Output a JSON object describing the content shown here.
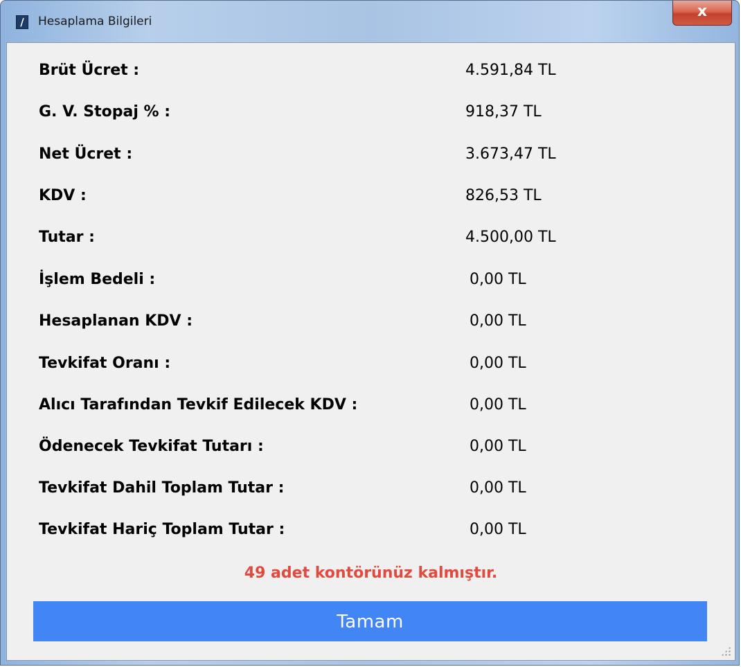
{
  "window": {
    "title": "Hesaplama Bilgileri",
    "app_icon": "app-logo-icon",
    "close_icon": "close-icon",
    "close_glyph": "x"
  },
  "rows": [
    {
      "label": "Brüt Ücret :",
      "value": "4.591,84 TL"
    },
    {
      "label": "G. V.  Stopaj % :",
      "value": "918,37 TL"
    },
    {
      "label": "Net Ücret :",
      "value": "3.673,47 TL"
    },
    {
      "label": "KDV :",
      "value": "826,53 TL"
    },
    {
      "label": "Tutar :",
      "value": "4.500,00 TL"
    },
    {
      "label": "İşlem Bedeli :",
      "value": "0,00 TL"
    },
    {
      "label": "Hesaplanan KDV :",
      "value": "0,00 TL"
    },
    {
      "label": "Tevkifat Oranı :",
      "value": "0,00 TL"
    },
    {
      "label": "Alıcı Tarafından Tevkif Edilecek KDV :",
      "value": "0,00 TL"
    },
    {
      "label": "Ödenecek Tevkifat Tutarı :",
      "value": "0,00 TL"
    },
    {
      "label": "Tevkifat Dahil Toplam Tutar :",
      "value": "0,00 TL"
    },
    {
      "label": "Tevkifat Hariç Toplam Tutar :",
      "value": "0,00 TL"
    }
  ],
  "notice": "49 adet kontörünüz kalmıştır.",
  "ok_button_label": "Tamam",
  "colors": {
    "notice": "#e04a3f",
    "button": "#4285f4",
    "client_bg": "#f0f0f0"
  }
}
